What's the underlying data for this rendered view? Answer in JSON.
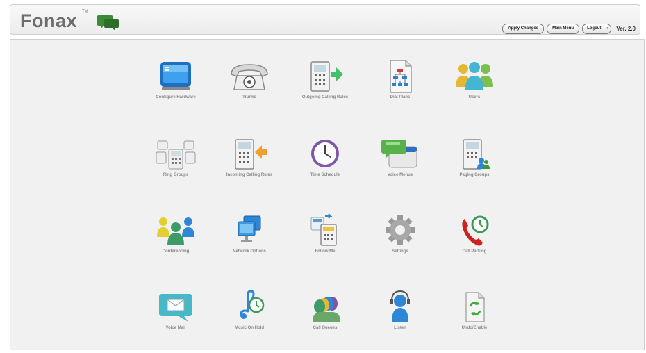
{
  "header": {
    "logo_text": "Fonax",
    "logo_tm": "TM",
    "apply_changes_label": "Apply Changes",
    "main_menu_label": "Main Menu",
    "logout_label": "Logout",
    "logout_caret": "▾",
    "version": "Ver. 2.0"
  },
  "menu": {
    "row1": [
      {
        "label": "Configure Hardware",
        "icon": "hardware-icon"
      },
      {
        "label": "Trunks",
        "icon": "phone-icon"
      },
      {
        "label": "Outgoing Calling Rules",
        "icon": "outgoing-rules-icon"
      },
      {
        "label": "Dial Plans",
        "icon": "dial-plan-icon"
      },
      {
        "label": "Users",
        "icon": "users-icon"
      }
    ],
    "row2": [
      {
        "label": "Ring Groups",
        "icon": "ring-groups-icon"
      },
      {
        "label": "Incoming Calling Rules",
        "icon": "incoming-rules-icon"
      },
      {
        "label": "Time Schedule",
        "icon": "clock-icon"
      },
      {
        "label": "Voice Menus",
        "icon": "voice-menus-icon"
      },
      {
        "label": "Paging Groups",
        "icon": "paging-groups-icon"
      }
    ],
    "row3": [
      {
        "label": "Conferencing",
        "icon": "conferencing-icon"
      },
      {
        "label": "Network Options",
        "icon": "network-icon"
      },
      {
        "label": "Follow Me",
        "icon": "follow-me-icon"
      },
      {
        "label": "Settings",
        "icon": "gear-icon"
      },
      {
        "label": "Call Parking",
        "icon": "call-parking-icon"
      }
    ],
    "row4": [
      {
        "label": "Voice Mail",
        "icon": "voicemail-icon"
      },
      {
        "label": "Music On Hold",
        "icon": "music-icon"
      },
      {
        "label": "Call Queues",
        "icon": "call-queues-icon"
      },
      {
        "label": "Listen",
        "icon": "headset-icon"
      },
      {
        "label": "Undo/Enable",
        "icon": "undo-icon"
      }
    ]
  },
  "colors": {
    "brand_gray": "#6d6d6d",
    "brand_green": "#3f8a3a",
    "icon_blue": "#2e86d6",
    "icon_teal": "#48b8c8",
    "accent_red": "#cc2222"
  }
}
